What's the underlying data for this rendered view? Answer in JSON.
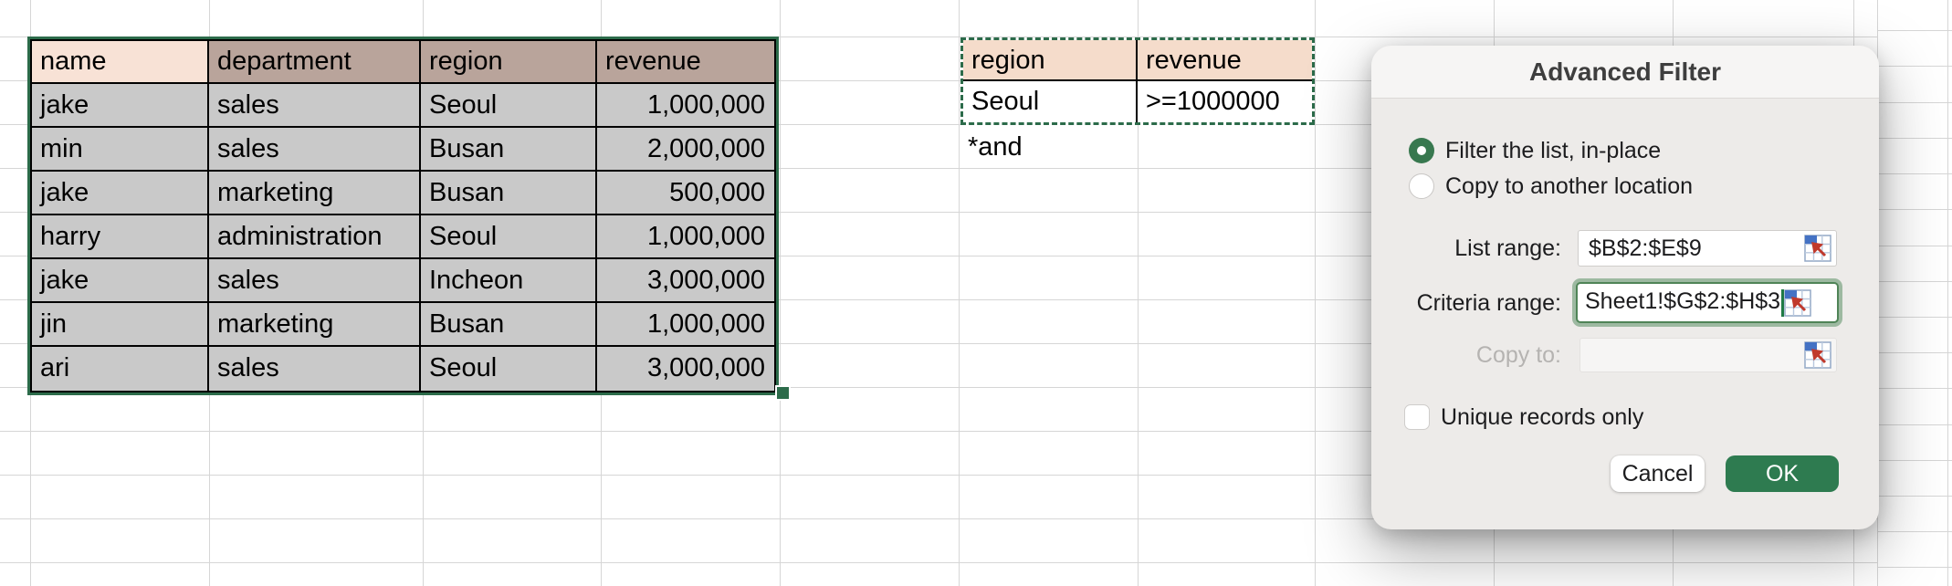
{
  "colors": {
    "selection_green": "#2c6b4a",
    "ok_button_green": "#2e7b50",
    "focus_ring_green": "#9db9a1",
    "caret_green": "#1f7a46",
    "header_peach_name": "#f8e2d6",
    "header_mauve": "#b9a49b",
    "criteria_header_peach": "#f5dccb",
    "data_cell_gray": "#c9c9c9"
  },
  "main_table": {
    "headers": [
      "name",
      "department",
      "region",
      "revenue"
    ],
    "rows": [
      [
        "jake",
        "sales",
        "Seoul",
        "1,000,000"
      ],
      [
        "min",
        "sales",
        "Busan",
        "2,000,000"
      ],
      [
        "jake",
        "marketing",
        "Busan",
        "500,000"
      ],
      [
        "harry",
        "administration",
        "Seoul",
        "1,000,000"
      ],
      [
        "jake",
        "sales",
        "Incheon",
        "3,000,000"
      ],
      [
        "jin",
        "marketing",
        "Busan",
        "1,000,000"
      ],
      [
        "ari",
        "sales",
        "Seoul",
        "3,000,000"
      ]
    ]
  },
  "criteria_table": {
    "headers": [
      "region",
      "revenue"
    ],
    "rows": [
      [
        "Seoul",
        ">=1000000"
      ]
    ],
    "note": "*and"
  },
  "dialog": {
    "title": "Advanced Filter",
    "radio_filter_label": "Filter the list, in-place",
    "radio_copy_label": "Copy to another location",
    "radio_selected": "filter_in_place",
    "list_range_label": "List range:",
    "list_range_value": "$B$2:$E$9",
    "criteria_range_label": "Criteria range:",
    "criteria_range_value": "Sheet1!$G$2:$H$3",
    "copy_to_label": "Copy to:",
    "copy_to_value": "",
    "unique_label": "Unique records only",
    "unique_checked": false,
    "cancel_label": "Cancel",
    "ok_label": "OK"
  }
}
